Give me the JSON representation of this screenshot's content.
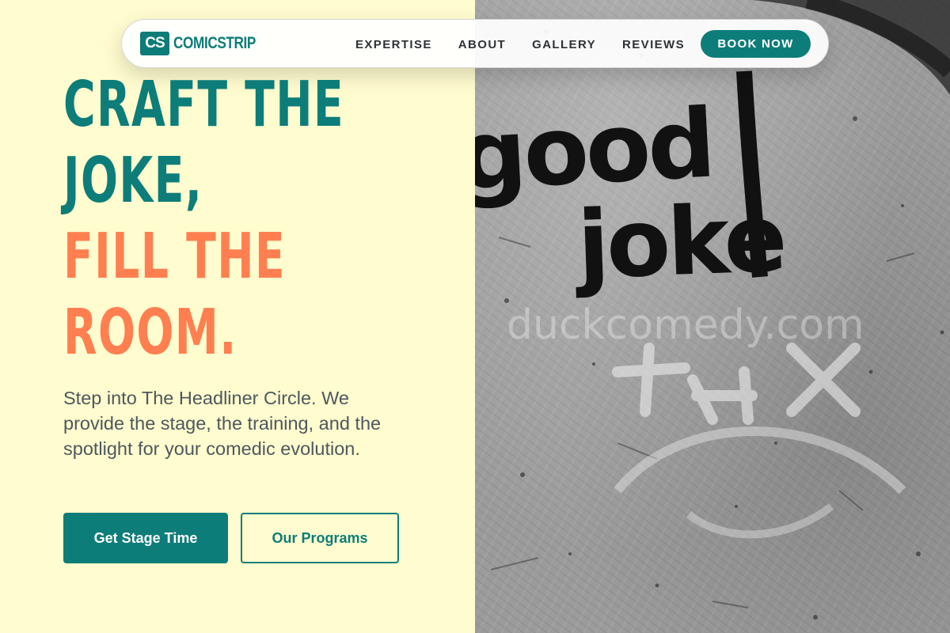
{
  "brand": {
    "mark": "CS",
    "name": "COMICSTRIP",
    "color": "#0d7d79"
  },
  "nav": {
    "links": [
      "EXPERTISE",
      "ABOUT",
      "GALLERY",
      "REVIEWS"
    ],
    "cta": "BOOK NOW"
  },
  "hero": {
    "headline_line1": "CRAFT THE",
    "headline_line2": "JOKE,",
    "headline_line3": "FILL THE",
    "headline_line4": "ROOM.",
    "subtitle": "Step into The Headliner Circle. We provide the stage, the training, and the spotlight for your comedic evolution.",
    "primary_button": "Get Stage Time",
    "secondary_button": "Our Programs"
  },
  "image": {
    "graffiti_text": "good joke",
    "watermark": "duckcomedy.com",
    "scratch_text": "+HX"
  },
  "colors": {
    "background": "#fffccf",
    "teal": "#0d7d79",
    "coral": "#ff7f50",
    "text": "#4e585e"
  }
}
